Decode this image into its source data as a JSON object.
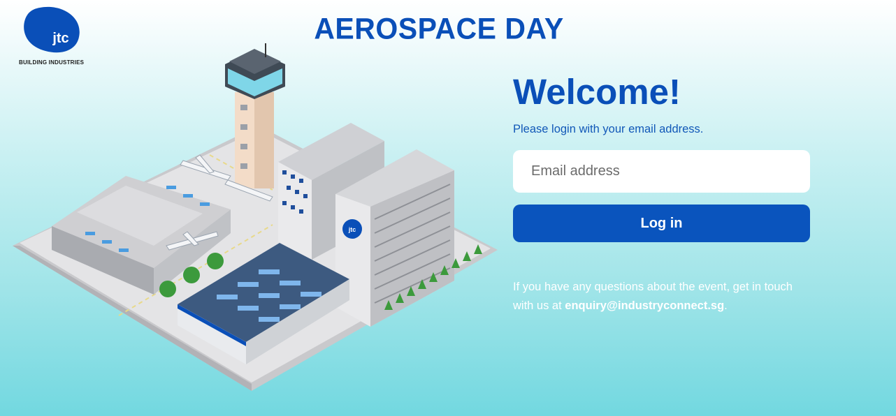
{
  "brand": {
    "logo_text": "jtc",
    "logo_subtitle": "BUILDING INDUSTRIES",
    "logo_color": "#0a4fb8"
  },
  "header": {
    "title": "AEROSPACE DAY"
  },
  "illustration": {
    "badge_text": "jtc"
  },
  "login": {
    "heading": "Welcome!",
    "subtitle": "Please login with your email address.",
    "email_placeholder": "Email address",
    "email_value": "",
    "submit_label": "Log in",
    "help_prefix": "If you have any questions about the event, get in touch with us at ",
    "help_email": "enquiry@industryconnect.sg",
    "help_suffix": "."
  },
  "colors": {
    "primary": "#0a4fb8",
    "button": "#0a54bd",
    "bg_top": "#ffffff",
    "bg_bottom": "#72d8e0"
  }
}
